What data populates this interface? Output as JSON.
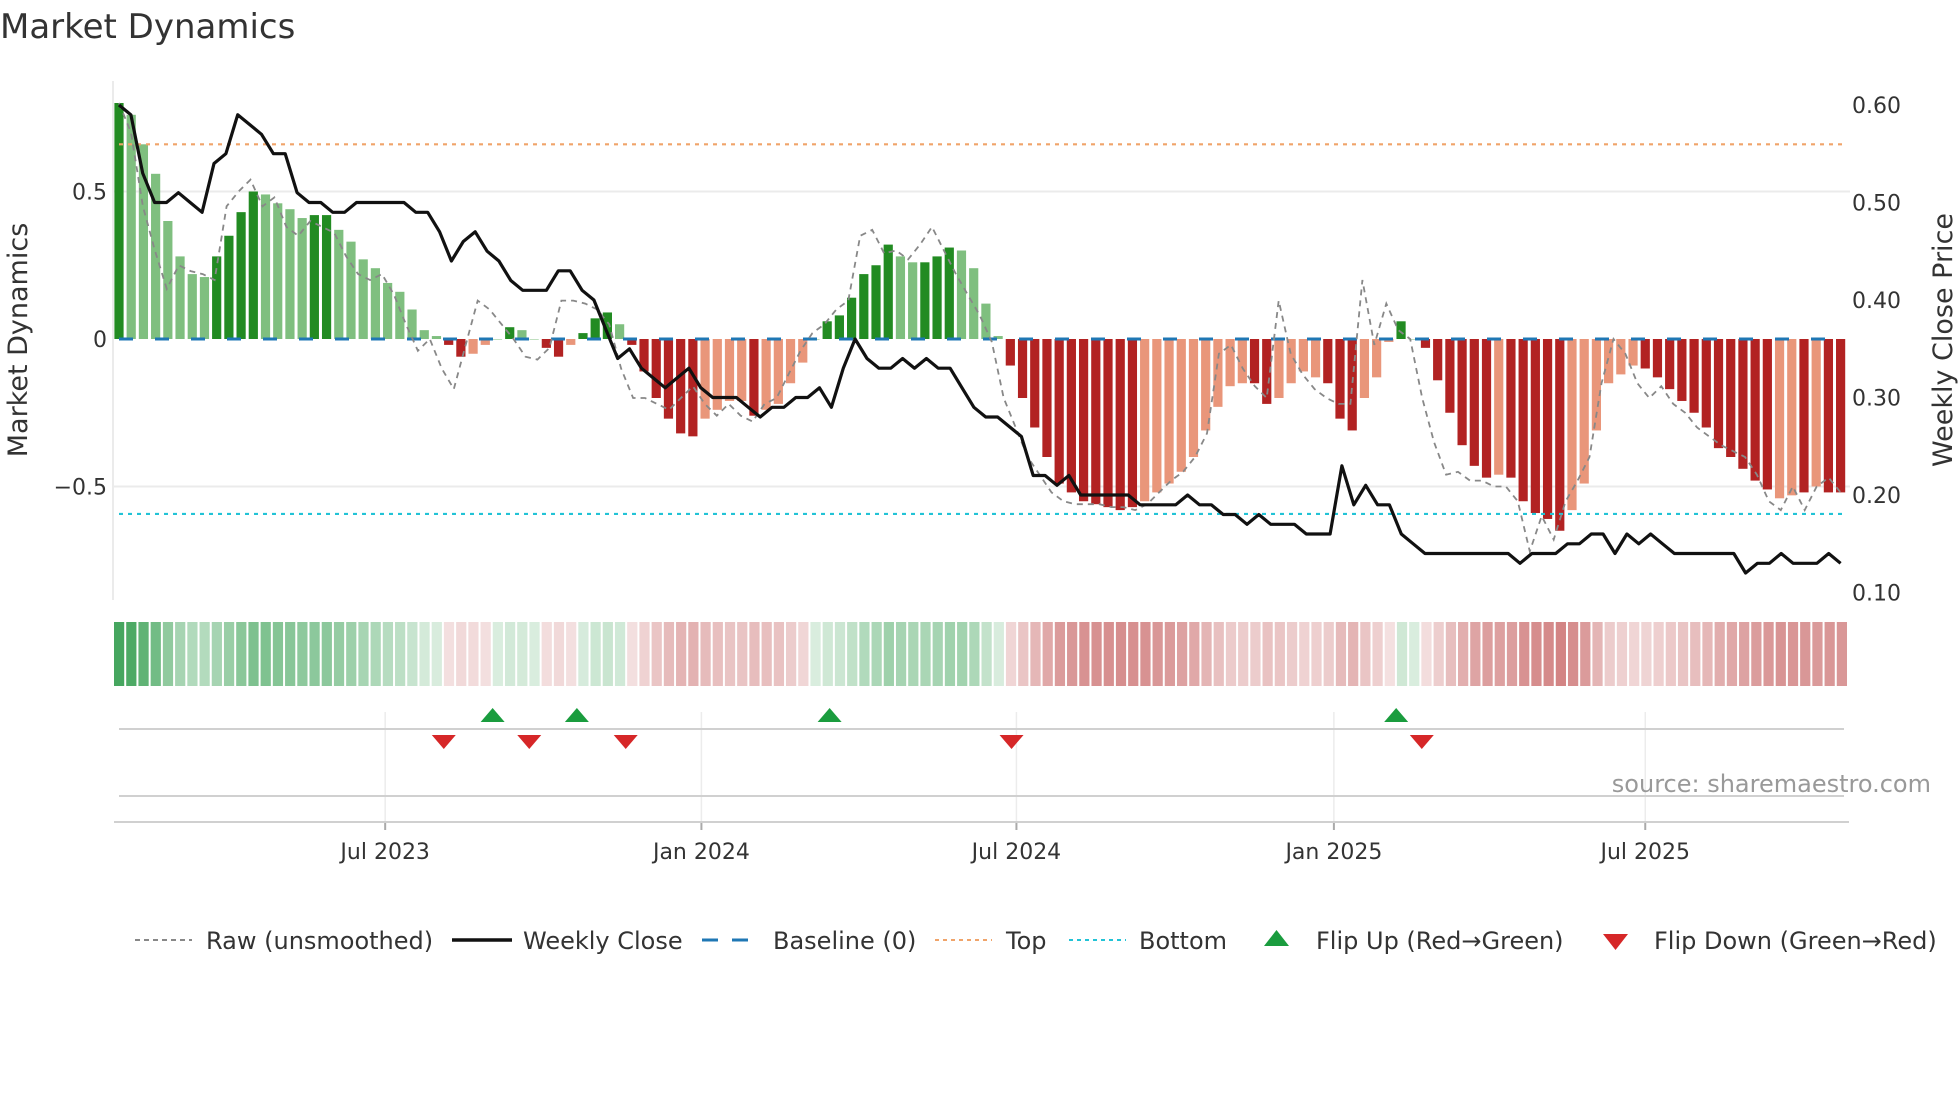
{
  "title": "Market Dynamics",
  "source": "source: sharemaestro.com",
  "chart_data": {
    "type": "bar",
    "title": "Market Dynamics",
    "ylabel": "Market Dynamics",
    "y2label": "Weekly Close Price",
    "ylim": [
      -0.88,
      0.87
    ],
    "y2lim": [
      0.1,
      0.6
    ],
    "yticks": [
      {
        "v": 0.5,
        "label": "0.5"
      },
      {
        "v": 0,
        "label": "0"
      },
      {
        "v": -0.5,
        "label": "−0.5"
      }
    ],
    "y2ticks": [
      {
        "v": 0.6,
        "label": "0.60"
      },
      {
        "v": 0.5,
        "label": "0.50"
      },
      {
        "v": 0.4,
        "label": "0.40"
      },
      {
        "v": 0.3,
        "label": "0.30"
      },
      {
        "v": 0.2,
        "label": "0.20"
      },
      {
        "v": 0.1,
        "label": "0.10"
      }
    ],
    "xticks": [
      {
        "week": 21.8,
        "label": "Jul 2023"
      },
      {
        "week": 47.7,
        "label": "Jan 2024"
      },
      {
        "week": 73.5,
        "label": "Jul 2024"
      },
      {
        "week": 99.5,
        "label": "Jan 2025"
      },
      {
        "week": 125,
        "label": "Jul 2025"
      }
    ],
    "top_level": 0.66,
    "bottom_level": -0.593,
    "baseline": 0,
    "colors": {
      "strong_up": "#228b22",
      "weak_up": "#7fbf7f",
      "strong_down": "#b22222",
      "weak_down": "#e9967a",
      "price": "#111111",
      "raw": "#888888",
      "baseline": "#1f77b4",
      "top": "#f0a46a",
      "bottom": "#22c3d6",
      "flip_up": "#1a9c3e",
      "flip_down": "#d62728"
    },
    "dynamics": [
      0.8,
      0.76,
      0.66,
      0.56,
      0.4,
      0.28,
      0.22,
      0.21,
      0.28,
      0.35,
      0.43,
      0.5,
      0.49,
      0.46,
      0.44,
      0.41,
      0.42,
      0.42,
      0.37,
      0.33,
      0.27,
      0.24,
      0.19,
      0.16,
      0.1,
      0.03,
      0.01,
      -0.02,
      -0.06,
      -0.05,
      -0.02,
      0,
      0.04,
      0.03,
      0,
      -0.03,
      -0.06,
      -0.02,
      0.02,
      0.07,
      0.09,
      0.05,
      -0.02,
      -0.11,
      -0.2,
      -0.27,
      -0.32,
      -0.33,
      -0.27,
      -0.24,
      -0.21,
      -0.21,
      -0.26,
      -0.24,
      -0.22,
      -0.15,
      -0.08,
      0,
      0.06,
      0.08,
      0.14,
      0.22,
      0.25,
      0.32,
      0.28,
      0.26,
      0.26,
      0.28,
      0.31,
      0.3,
      0.24,
      0.12,
      0.01,
      -0.09,
      -0.2,
      -0.3,
      -0.4,
      -0.49,
      -0.52,
      -0.55,
      -0.56,
      -0.57,
      -0.58,
      -0.57,
      -0.55,
      -0.52,
      -0.49,
      -0.45,
      -0.4,
      -0.31,
      -0.23,
      -0.16,
      -0.15,
      -0.15,
      -0.22,
      -0.2,
      -0.15,
      -0.11,
      -0.13,
      -0.15,
      -0.27,
      -0.31,
      -0.2,
      -0.13,
      -0.01,
      0.06,
      0,
      -0.03,
      -0.14,
      -0.25,
      -0.36,
      -0.43,
      -0.47,
      -0.46,
      -0.47,
      -0.55,
      -0.59,
      -0.61,
      -0.65,
      -0.58,
      -0.49,
      -0.31,
      -0.15,
      -0.12,
      -0.09,
      -0.1,
      -0.13,
      -0.17,
      -0.21,
      -0.25,
      -0.3,
      -0.37,
      -0.4,
      -0.44,
      -0.48,
      -0.51,
      -0.54,
      -0.53,
      -0.52,
      -0.5,
      -0.52,
      -0.52
    ],
    "strong": [
      1,
      0,
      0,
      0,
      0,
      0,
      0,
      0,
      1,
      1,
      1,
      1,
      0,
      0,
      0,
      0,
      1,
      1,
      0,
      0,
      0,
      0,
      0,
      0,
      0,
      0,
      0,
      1,
      1,
      0,
      0,
      0,
      1,
      0,
      0,
      1,
      1,
      0,
      1,
      1,
      1,
      0,
      1,
      1,
      1,
      1,
      1,
      1,
      0,
      0,
      0,
      0,
      1,
      0,
      0,
      0,
      0,
      0,
      1,
      1,
      1,
      1,
      1,
      1,
      0,
      0,
      1,
      1,
      1,
      0,
      0,
      0,
      0,
      1,
      1,
      1,
      1,
      1,
      1,
      1,
      1,
      1,
      1,
      1,
      0,
      0,
      0,
      0,
      0,
      0,
      0,
      0,
      0,
      1,
      1,
      0,
      0,
      0,
      0,
      1,
      1,
      1,
      0,
      0,
      0,
      1,
      0,
      1,
      1,
      1,
      1,
      1,
      1,
      0,
      1,
      1,
      1,
      1,
      1,
      0,
      0,
      0,
      0,
      0,
      0,
      1,
      1,
      1,
      1,
      1,
      1,
      1,
      1,
      1,
      1,
      1,
      0,
      0,
      1,
      0,
      1,
      1
    ],
    "raw": [
      0.8,
      0.7,
      0.45,
      0.3,
      0.17,
      0.25,
      0.23,
      0.22,
      0.2,
      0.45,
      0.5,
      0.54,
      0.45,
      0.48,
      0.38,
      0.35,
      0.4,
      0.38,
      0.36,
      0.28,
      0.22,
      0.2,
      0.22,
      0.15,
      0.05,
      -0.04,
      0,
      -0.1,
      -0.17,
      -0.02,
      0.13,
      0.1,
      0.05,
      0,
      -0.06,
      -0.07,
      -0.03,
      0.13,
      0.13,
      0.12,
      0.1,
      0.05,
      -0.1,
      -0.2,
      -0.2,
      -0.22,
      -0.24,
      -0.2,
      -0.16,
      -0.22,
      -0.26,
      -0.22,
      -0.26,
      -0.28,
      -0.22,
      -0.2,
      -0.12,
      -0.04,
      0.02,
      0.05,
      0.1,
      0.13,
      0.35,
      0.37,
      0.29,
      0.3,
      0.27,
      0.32,
      0.38,
      0.3,
      0.22,
      0.15,
      0.08,
      -0.01,
      -0.2,
      -0.3,
      -0.4,
      -0.46,
      -0.52,
      -0.55,
      -0.56,
      -0.56,
      -0.56,
      -0.57,
      -0.57,
      -0.58,
      -0.56,
      -0.52,
      -0.48,
      -0.45,
      -0.4,
      -0.32,
      -0.05,
      -0.02,
      -0.1,
      -0.16,
      -0.2,
      0.13,
      -0.05,
      -0.12,
      -0.17,
      -0.2,
      -0.22,
      -0.22,
      0.2,
      -0.02,
      0.12,
      0.03,
      0.0,
      -0.2,
      -0.35,
      -0.46,
      -0.45,
      -0.48,
      -0.48,
      -0.5,
      -0.5,
      -0.55,
      -0.72,
      -0.6,
      -0.68,
      -0.55,
      -0.48,
      -0.4,
      -0.15,
      0.0,
      -0.05,
      -0.15,
      -0.2,
      -0.16,
      -0.22,
      -0.25,
      -0.3,
      -0.33,
      -0.36,
      -0.38,
      -0.4,
      -0.46,
      -0.55,
      -0.58,
      -0.5,
      -0.58,
      -0.5,
      -0.47,
      -0.52
    ],
    "price": [
      0.6,
      0.59,
      0.53,
      0.5,
      0.5,
      0.51,
      0.5,
      0.49,
      0.54,
      0.55,
      0.59,
      0.58,
      0.57,
      0.55,
      0.55,
      0.51,
      0.5,
      0.5,
      0.49,
      0.49,
      0.5,
      0.5,
      0.5,
      0.5,
      0.5,
      0.49,
      0.49,
      0.47,
      0.44,
      0.46,
      0.47,
      0.45,
      0.44,
      0.42,
      0.41,
      0.41,
      0.41,
      0.43,
      0.43,
      0.41,
      0.4,
      0.37,
      0.34,
      0.35,
      0.33,
      0.32,
      0.31,
      0.32,
      0.33,
      0.31,
      0.3,
      0.3,
      0.3,
      0.29,
      0.28,
      0.29,
      0.29,
      0.3,
      0.3,
      0.31,
      0.29,
      0.33,
      0.36,
      0.34,
      0.33,
      0.33,
      0.34,
      0.33,
      0.34,
      0.33,
      0.33,
      0.31,
      0.29,
      0.28,
      0.28,
      0.27,
      0.26,
      0.22,
      0.22,
      0.21,
      0.22,
      0.2,
      0.2,
      0.2,
      0.2,
      0.2,
      0.19,
      0.19,
      0.19,
      0.19,
      0.2,
      0.19,
      0.19,
      0.18,
      0.18,
      0.17,
      0.18,
      0.17,
      0.17,
      0.17,
      0.16,
      0.16,
      0.16,
      0.23,
      0.19,
      0.21,
      0.19,
      0.19,
      0.16,
      0.15,
      0.14,
      0.14,
      0.14,
      0.14,
      0.14,
      0.14,
      0.14,
      0.14,
      0.13,
      0.14,
      0.14,
      0.14,
      0.15,
      0.15,
      0.16,
      0.16,
      0.14,
      0.16,
      0.15,
      0.16,
      0.15,
      0.14,
      0.14,
      0.14,
      0.14,
      0.14,
      0.14,
      0.12,
      0.13,
      0.13,
      0.14,
      0.13,
      0.13,
      0.13,
      0.14,
      0.13
    ],
    "flips_up": [
      30.6,
      37.5,
      58.2,
      104.6
    ],
    "flips_down": [
      26.6,
      33.6,
      41.5,
      73.1,
      106.7
    ],
    "legend": [
      "Raw (unsmoothed)",
      "Weekly Close",
      "Baseline (0)",
      "Top",
      "Bottom",
      "Flip Up (Red→Green)",
      "Flip Down (Green→Red)"
    ],
    "legend_placement": "bottom"
  }
}
